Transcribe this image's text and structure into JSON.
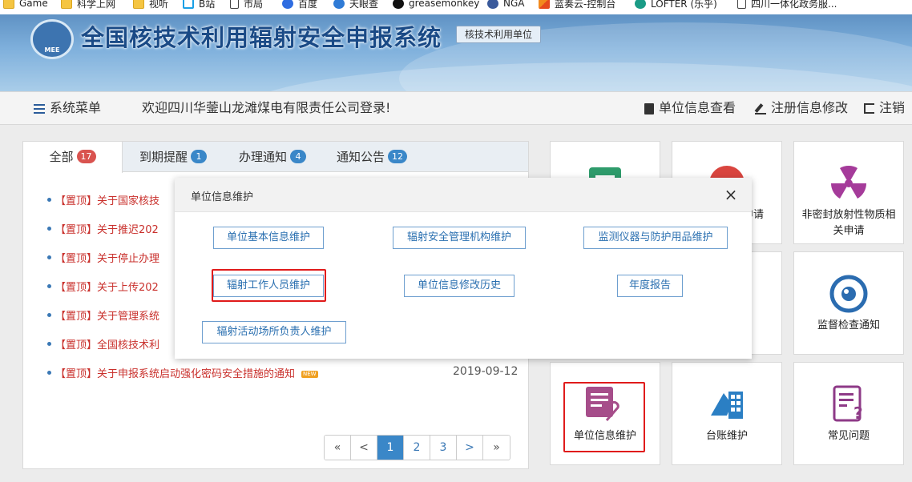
{
  "bookmarks": [
    {
      "label": "Game",
      "icon": "folder-icon"
    },
    {
      "label": "科学上网",
      "icon": "folder-icon"
    },
    {
      "label": "视听",
      "icon": "folder-icon"
    },
    {
      "label": "B站",
      "icon": "bilibili-icon"
    },
    {
      "label": "市局",
      "icon": "page-icon"
    },
    {
      "label": "百度",
      "icon": "baidu-icon"
    },
    {
      "label": "天眼查",
      "icon": "tianyancha-icon"
    },
    {
      "label": "greasemonkey",
      "icon": "greasemonkey-icon"
    },
    {
      "label": "NGA",
      "icon": "nga-icon"
    },
    {
      "label": "蓝奏云-控制台",
      "icon": "lanzou-icon"
    },
    {
      "label": "LOFTER (乐乎)",
      "icon": "lofter-icon"
    },
    {
      "label": "四川一体化政务服...",
      "icon": "page-icon"
    }
  ],
  "header": {
    "logo_text": "MEE",
    "title": "全国核技术利用辐射安全申报系统",
    "user_type": "核技术利用单位"
  },
  "navbar": {
    "menu_label": "系统菜单",
    "welcome": "欢迎四川华蓥山龙滩煤电有限责任公司登录!",
    "view_info": "单位信息查看",
    "edit_registration": "注册信息修改",
    "logout": "注销"
  },
  "tabs": [
    {
      "label": "全部",
      "count": "17"
    },
    {
      "label": "到期提醒",
      "count": "1"
    },
    {
      "label": "办理通知",
      "count": "4"
    },
    {
      "label": "通知公告",
      "count": "12"
    }
  ],
  "notices": [
    {
      "text": "【置顶】关于国家核技"
    },
    {
      "text": "【置顶】关于推迟202"
    },
    {
      "text": "【置顶】关于停止办理"
    },
    {
      "text": "【置顶】关于上传202"
    },
    {
      "text": "【置顶】关于管理系统"
    },
    {
      "text": "【置顶】全国核技术利"
    },
    {
      "text": "【置顶】关于申报系统启动强化密码安全措施的通知",
      "tag": "NEW",
      "date": "2019-09-12"
    }
  ],
  "pagination": [
    "«",
    "<",
    "1",
    "2",
    "3",
    ">",
    "»"
  ],
  "tiles": [
    {
      "label": ""
    },
    {
      "label": "申请"
    },
    {
      "label": "非密封放射性物质相关申请"
    },
    {
      "label": ""
    },
    {
      "label": ""
    },
    {
      "label": "监督检查通知"
    },
    {
      "label": "单位信息维护"
    },
    {
      "label": "台账维护"
    },
    {
      "label": "常见问题"
    }
  ],
  "modal": {
    "title": "单位信息维护",
    "close": "×",
    "buttons": [
      "单位基本信息维护",
      "辐射安全管理机构维护",
      "监测仪器与防护用品维护",
      "辐射工作人员维护",
      "单位信息修改历史",
      "年度报告",
      "辐射活动场所负责人维护"
    ]
  },
  "colors": {
    "accent": "#3a87c8",
    "notice_red": "#c9302c",
    "highlight": "#e01b1b",
    "title_blue": "#1a4a86"
  }
}
